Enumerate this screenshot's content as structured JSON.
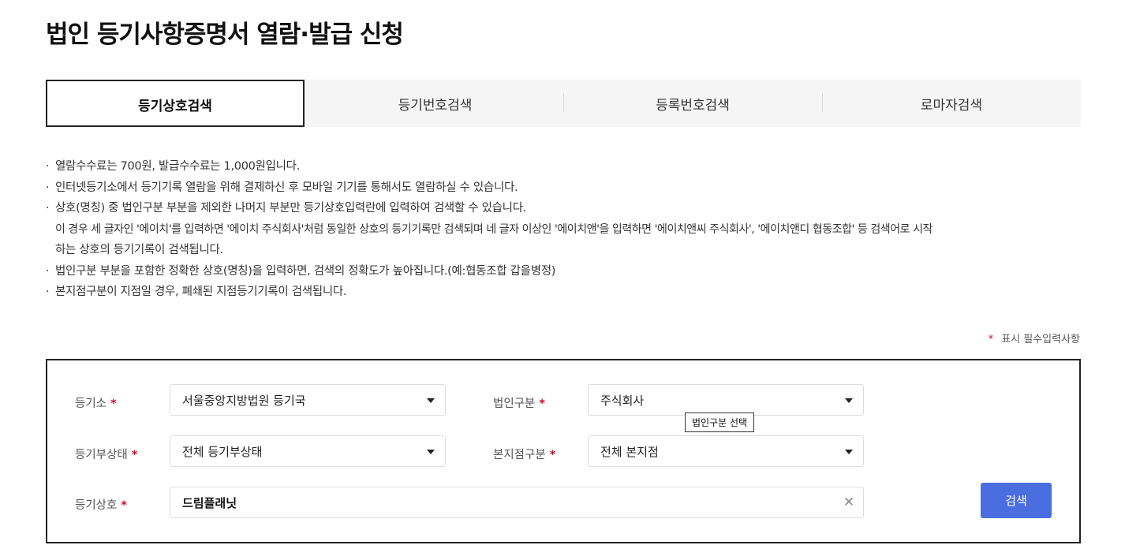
{
  "page": {
    "title": "법인 등기사항증명서 열람·발급 신청"
  },
  "tabs": [
    {
      "label": "등기상호검색",
      "active": true
    },
    {
      "label": "등기번호검색",
      "active": false
    },
    {
      "label": "등록번호검색",
      "active": false
    },
    {
      "label": "로마자검색",
      "active": false
    }
  ],
  "notes": {
    "bullet": "·",
    "items": [
      {
        "lines": [
          "열람수수료는 700원, 발급수수료는 1,000원입니다."
        ]
      },
      {
        "lines": [
          "인터넷등기소에서 등기기록 열람을 위해 결제하신 후 모바일 기기를 통해서도 열람하실 수 있습니다."
        ]
      },
      {
        "lines": [
          "상호(명칭) 중 법인구분 부분을 제외한 나머지 부분만 등기상호입력란에 입력하여 검색할 수 있습니다.",
          "이 경우 세 글자인 '에이치'를 입력하면 '에이치 주식회사'처럼 동일한 상호의 등기기록만 검색되며 네 글자 이상인 '에이치앤'을 입력하면 '에이치앤씨 주식회사', '에이치앤디 협동조합' 등 검색어로 시작",
          "하는 상호의 등기기록이 검색됩니다."
        ]
      },
      {
        "lines": [
          "법인구분 부분을 포함한 정확한 상호(명칭)을 입력하면, 검색의 정확도가 높아집니다.(예:협동조합 갑을병정)"
        ]
      },
      {
        "lines": [
          "본지점구분이 지점일 경우, 폐쇄된 지점등기기록이 검색됩니다."
        ]
      }
    ]
  },
  "required_note": {
    "star": "*",
    "text": "표시 필수입력사항"
  },
  "form": {
    "required_mark": "*",
    "registry": {
      "label": "등기소",
      "value": "서울중앙지방법원 등기국"
    },
    "corp_type": {
      "label": "법인구분",
      "value": "주식회사",
      "tooltip": "법인구분 선택"
    },
    "status": {
      "label": "등기부상태",
      "value": "전체 등기부상태"
    },
    "branch": {
      "label": "본지점구분",
      "value": "전체 본지점"
    },
    "company_name": {
      "label": "등기상호",
      "value": "드림플래닛"
    },
    "clear_glyph": "✕",
    "search_label": "검색"
  },
  "colors": {
    "accent": "#4a6ee0",
    "required": "#c8102e",
    "tab_bg": "#f5f5f5",
    "border_dark": "#222222"
  }
}
